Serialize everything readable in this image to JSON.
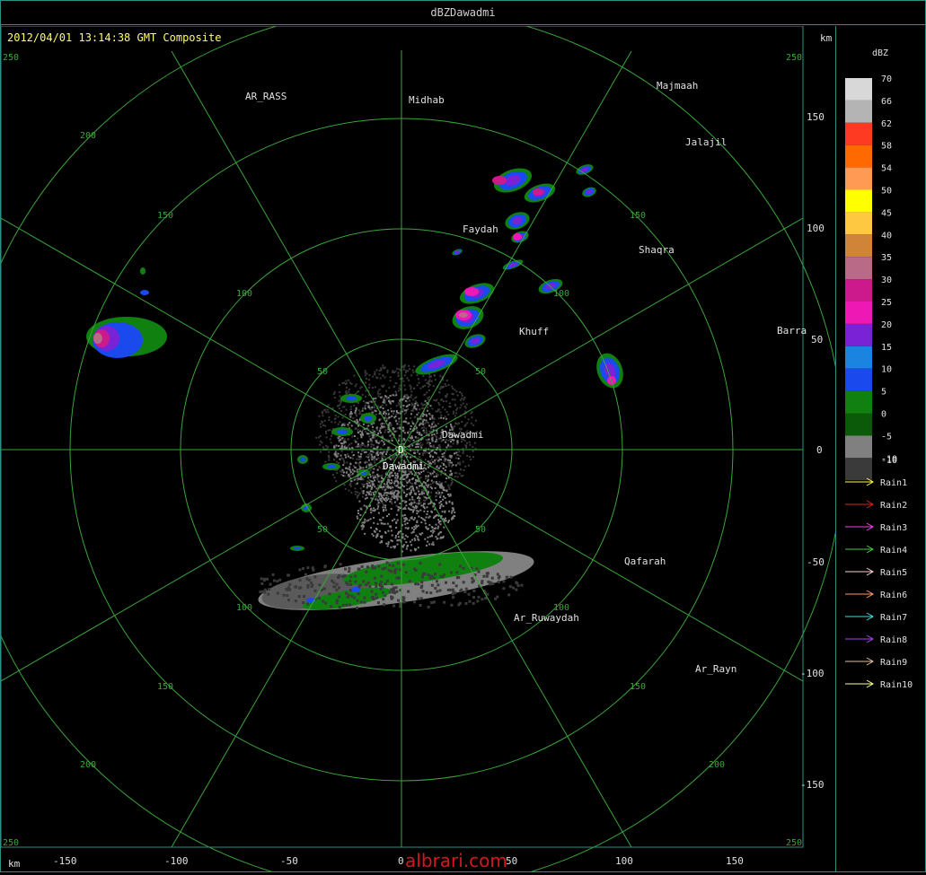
{
  "window": {
    "title": "dBZDawadmi"
  },
  "header": {
    "timestamp": "2012/04/01 13:14:38 GMT Composite"
  },
  "units": {
    "km_top": "km",
    "km_bottom": "km"
  },
  "station": {
    "marker": "D",
    "name": "Dawadmi"
  },
  "cities": [
    "AR_RASS",
    "Midhab",
    "Majmaah",
    "Jalajil",
    "Faydah",
    "Shaqra",
    "Barra",
    "Khuff",
    "Dawadmi",
    "Qafarah",
    "Ar_Ruwaydah",
    "Ar_Rayn"
  ],
  "x_ticks": [
    "-150",
    "-100",
    "-50",
    "0",
    "50",
    "100",
    "150"
  ],
  "y_ticks": [
    "150",
    "100",
    "50",
    "0",
    "-50",
    "-100",
    "-150"
  ],
  "corner_labels": [
    "250",
    "250",
    "250",
    "250"
  ],
  "range_labels": [
    "50",
    "100",
    "150",
    "200"
  ],
  "legend": {
    "title": "dBZ",
    "levels": [
      {
        "label": "70",
        "color": "#d8d8d8"
      },
      {
        "label": "66",
        "color": "#b4b4b4"
      },
      {
        "label": "62",
        "color": "#ff3a22"
      },
      {
        "label": "58",
        "color": "#ff6a00"
      },
      {
        "label": "54",
        "color": "#ff9a55"
      },
      {
        "label": "50",
        "color": "#ffff00"
      },
      {
        "label": "45",
        "color": "#ffc840"
      },
      {
        "label": "40",
        "color": "#d08438"
      },
      {
        "label": "35",
        "color": "#b96a86"
      },
      {
        "label": "30",
        "color": "#cc1a8c"
      },
      {
        "label": "25",
        "color": "#ee18b4"
      },
      {
        "label": "20",
        "color": "#7a22d6"
      },
      {
        "label": "15",
        "color": "#1a84e0"
      },
      {
        "label": "10",
        "color": "#1a4aee"
      },
      {
        "label": "5",
        "color": "#108010"
      },
      {
        "label": "0",
        "color": "#0a5a0a"
      },
      {
        "label": "-5",
        "color": "#808080"
      },
      {
        "label": "-10",
        "color": "#3a3a3a"
      }
    ],
    "bottom_label": "-10"
  },
  "rain_gauges": [
    {
      "label": "Rain1",
      "color": "#ffff44"
    },
    {
      "label": "Rain2",
      "color": "#dd2222"
    },
    {
      "label": "Rain3",
      "color": "#ee44ee"
    },
    {
      "label": "Rain4",
      "color": "#44cc44"
    },
    {
      "label": "Rain5",
      "color": "#ffd0d0"
    },
    {
      "label": "Rain6",
      "color": "#ff9966"
    },
    {
      "label": "Rain7",
      "color": "#44dddd"
    },
    {
      "label": "Rain8",
      "color": "#aa44ee"
    },
    {
      "label": "Rain9",
      "color": "#e0c0a0"
    },
    {
      "label": "Rain10",
      "color": "#ffff99"
    }
  ],
  "colors": {
    "grid": "#3aa43a",
    "border": "#2f8f84",
    "label": "#e0e0e0",
    "ticks": "#e0e0e0"
  },
  "watermark": "albrari.com"
}
